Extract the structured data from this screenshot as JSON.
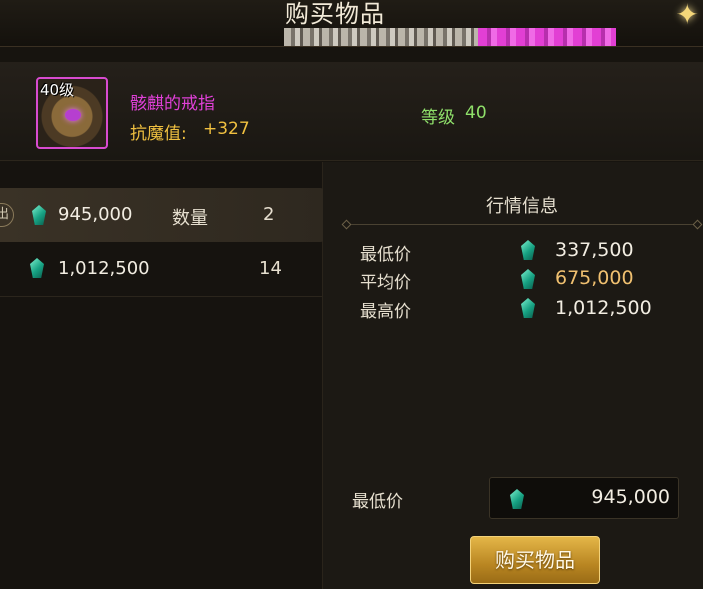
{
  "window": {
    "title": "购买物品"
  },
  "item": {
    "level_badge": "40级",
    "name": "骸麒的戒指",
    "stat_label": "抗魔值:",
    "stat_value": "+327",
    "level_label": "等级",
    "level_value": "40",
    "rarity_color": "#d84bd0"
  },
  "listings": [
    {
      "tag": "出",
      "price": "945,000",
      "qty_label": "数量",
      "qty": "2",
      "selected": true
    },
    {
      "price": "1,012,500",
      "qty": "14",
      "selected": false
    }
  ],
  "market": {
    "title": "行情信息",
    "rows": [
      {
        "label": "最低价",
        "value": "337,500"
      },
      {
        "label": "平均价",
        "value": "675,000"
      },
      {
        "label": "最高价",
        "value": "1,012,500"
      }
    ]
  },
  "purchase": {
    "min_price_label": "最低价",
    "min_price_value": "945,000",
    "buy_label": "购买物品"
  },
  "icons": {
    "currency": "crystal-gem-icon",
    "corner": "sparkle-icon"
  },
  "colors": {
    "accent_gold": "#e4b648",
    "level_green": "#8fe06a",
    "currency_teal": "#17a283"
  }
}
